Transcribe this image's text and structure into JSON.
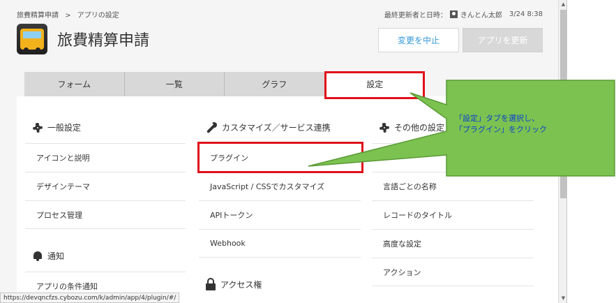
{
  "breadcrumb": {
    "root": "旅費精算申請",
    "separator": ">",
    "current": "アプリの設定"
  },
  "update_info": {
    "label": "最終更新者と日時：",
    "user": "きんとん太郎",
    "datetime": "3/24 8:38"
  },
  "app": {
    "title": "旅費精算申請",
    "icon": "bus-icon"
  },
  "actions": {
    "cancel_label": "変更を中止",
    "update_label": "アプリを更新"
  },
  "tabs": [
    {
      "label": "フォーム"
    },
    {
      "label": "一覧"
    },
    {
      "label": "グラフ"
    },
    {
      "label": "設定"
    }
  ],
  "columns": {
    "general": {
      "heading": "一般設定",
      "items": [
        "アイコンと説明",
        "デザインテーマ",
        "プロセス管理"
      ]
    },
    "notification": {
      "heading": "通知",
      "items": [
        "アプリの条件通知"
      ]
    },
    "customize": {
      "heading": "カスタマイズ／サービス連携",
      "items": [
        "プラグイン",
        "JavaScript / CSSでカスタマイズ",
        "APIトークン",
        "Webhook"
      ]
    },
    "access": {
      "heading": "アクセス権"
    },
    "other": {
      "heading": "その他の設定",
      "items": [
        "言語ごとの名称",
        "レコードのタイトル",
        "高度な設定",
        "アクション"
      ]
    }
  },
  "status_url": "https://devqncfzs.cybozu.com/k/admin/app/4/plugin/#/",
  "annotation": {
    "line1": "「設定」タブを選択し、",
    "line2": "「プラグイン」をクリック",
    "box_color": "#e0101c",
    "callout_color": "#7bc250",
    "text_color": "#0b3fd0"
  }
}
